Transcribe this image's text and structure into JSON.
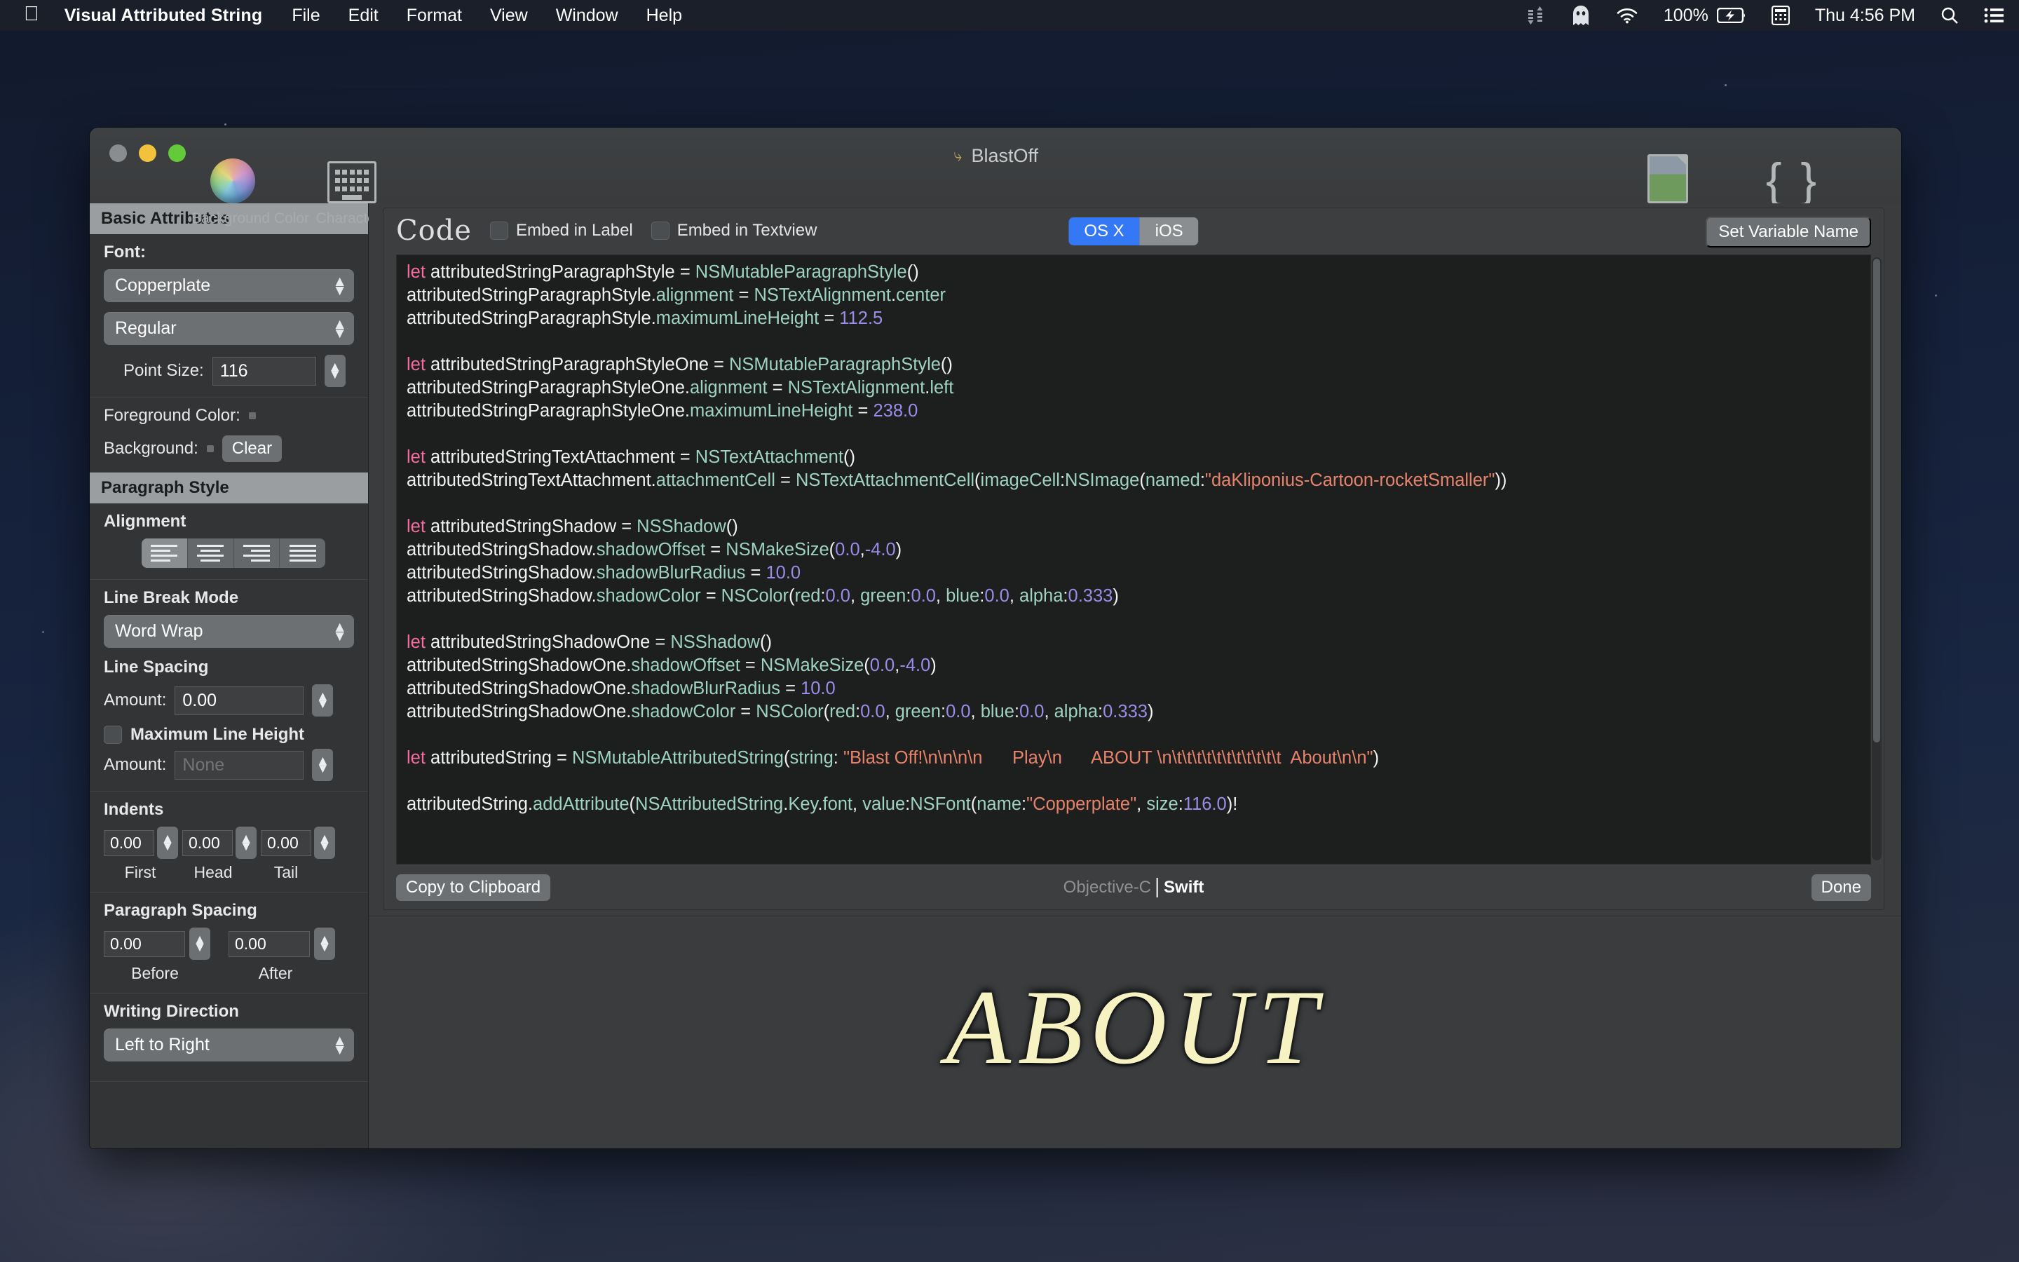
{
  "menubar": {
    "apple_glyph": "",
    "app_name": "Visual Attributed String",
    "items": [
      "File",
      "Edit",
      "Format",
      "View",
      "Window",
      "Help"
    ],
    "status": {
      "battery_percent": "100%",
      "clock": "Thu 4:56 PM",
      "icons": [
        "stats-icon",
        "ghost-icon",
        "wifi-icon",
        "battery-charging-icon",
        "calculator-icon",
        "search-icon",
        "list-icon"
      ]
    }
  },
  "window": {
    "title": "BlastOff",
    "toolbar_left": [
      {
        "label": "Background Color",
        "icon": "color-wheel-icon"
      },
      {
        "label": "Characters",
        "icon": "keyboard-icon"
      }
    ],
    "toolbar_right": [
      {
        "label": "Image",
        "icon": "image-file-icon"
      },
      {
        "label": "Code",
        "icon": "braces-icon"
      }
    ]
  },
  "sidebar": {
    "basic_attributes": {
      "header": "Basic Attributes",
      "font_label": "Font:",
      "font_family": "Copperplate",
      "font_style": "Regular",
      "point_size_label": "Point Size:",
      "point_size": "116",
      "foreground_label": "Foreground Color:",
      "foreground_color": "#f7f4c0",
      "background_label": "Background:",
      "clear_label": "Clear"
    },
    "paragraph_style": {
      "header": "Paragraph Style",
      "alignment_label": "Alignment",
      "alignment_options": [
        "align-left",
        "align-center",
        "align-right",
        "align-justify"
      ],
      "alignment_selected": 0,
      "line_break_label": "Line Break Mode",
      "line_break_value": "Word Wrap",
      "line_spacing_label": "Line Spacing",
      "amount_label": "Amount:",
      "line_spacing_amount": "0.00",
      "max_line_height_label": "Maximum Line Height",
      "max_line_height_checked": false,
      "max_line_height_amount_label": "Amount:",
      "max_line_height_amount_placeholder": "None",
      "indents_label": "Indents",
      "indents": [
        {
          "value": "0.00",
          "caption": "First"
        },
        {
          "value": "0.00",
          "caption": "Head"
        },
        {
          "value": "0.00",
          "caption": "Tail"
        }
      ],
      "paragraph_spacing_label": "Paragraph Spacing",
      "paragraph_spacing": [
        {
          "value": "0.00",
          "caption": "Before"
        },
        {
          "value": "0.00",
          "caption": "After"
        }
      ],
      "writing_direction_label": "Writing Direction",
      "writing_direction_value": "Left to Right"
    }
  },
  "code_panel": {
    "title": "Code",
    "embed_label": "Embed in Label",
    "embed_textview": "Embed in Textview",
    "embed_label_checked": false,
    "embed_textview_checked": false,
    "platform_options": [
      "OS X",
      "iOS"
    ],
    "platform_selected": "OS X",
    "set_variable_name": "Set Variable Name",
    "copy_to_clipboard": "Copy to Clipboard",
    "language_objc": "Objective-C",
    "language_swift": "Swift",
    "language_selected": "Swift",
    "done": "Done",
    "accent_color": "#3478f6",
    "code_lines": [
      "let attributedStringParagraphStyle = NSMutableParagraphStyle()",
      "attributedStringParagraphStyle.alignment = NSTextAlignment.center",
      "attributedStringParagraphStyle.maximumLineHeight = 112.5",
      "",
      "let attributedStringParagraphStyleOne = NSMutableParagraphStyle()",
      "attributedStringParagraphStyleOne.alignment = NSTextAlignment.left",
      "attributedStringParagraphStyleOne.maximumLineHeight = 238.0",
      "",
      "let attributedStringTextAttachment = NSTextAttachment()",
      "attributedStringTextAttachment.attachmentCell = NSTextAttachmentCell(imageCell:NSImage(named:\"daKliponius-Cartoon-rocketSmaller\"))",
      "",
      "let attributedStringShadow = NSShadow()",
      "attributedStringShadow.shadowOffset = NSMakeSize(0.0,-4.0)",
      "attributedStringShadow.shadowBlurRadius = 10.0",
      "attributedStringShadow.shadowColor = NSColor(red:0.0, green:0.0, blue:0.0, alpha:0.333)",
      "",
      "let attributedStringShadowOne = NSShadow()",
      "attributedStringShadowOne.shadowOffset = NSMakeSize(0.0,-4.0)",
      "attributedStringShadowOne.shadowBlurRadius = 10.0",
      "attributedStringShadowOne.shadowColor = NSColor(red:0.0, green:0.0, blue:0.0, alpha:0.333)",
      "",
      "let attributedString = NSMutableAttributedString(string: \"Blast Off!\\n\\n\\n\\n      Play\\n      ABOUT \\n\\t\\t\\t\\t\\t\\t\\t\\t\\t\\t\\t  About\\n\\n\")",
      "",
      "attributedString.addAttribute(NSAttributedString.Key.font, value:NSFont(name:\"Copperplate\", size:116.0)!"
    ]
  },
  "preview": {
    "text": "ABOUT",
    "color": "#f6f2c2"
  }
}
